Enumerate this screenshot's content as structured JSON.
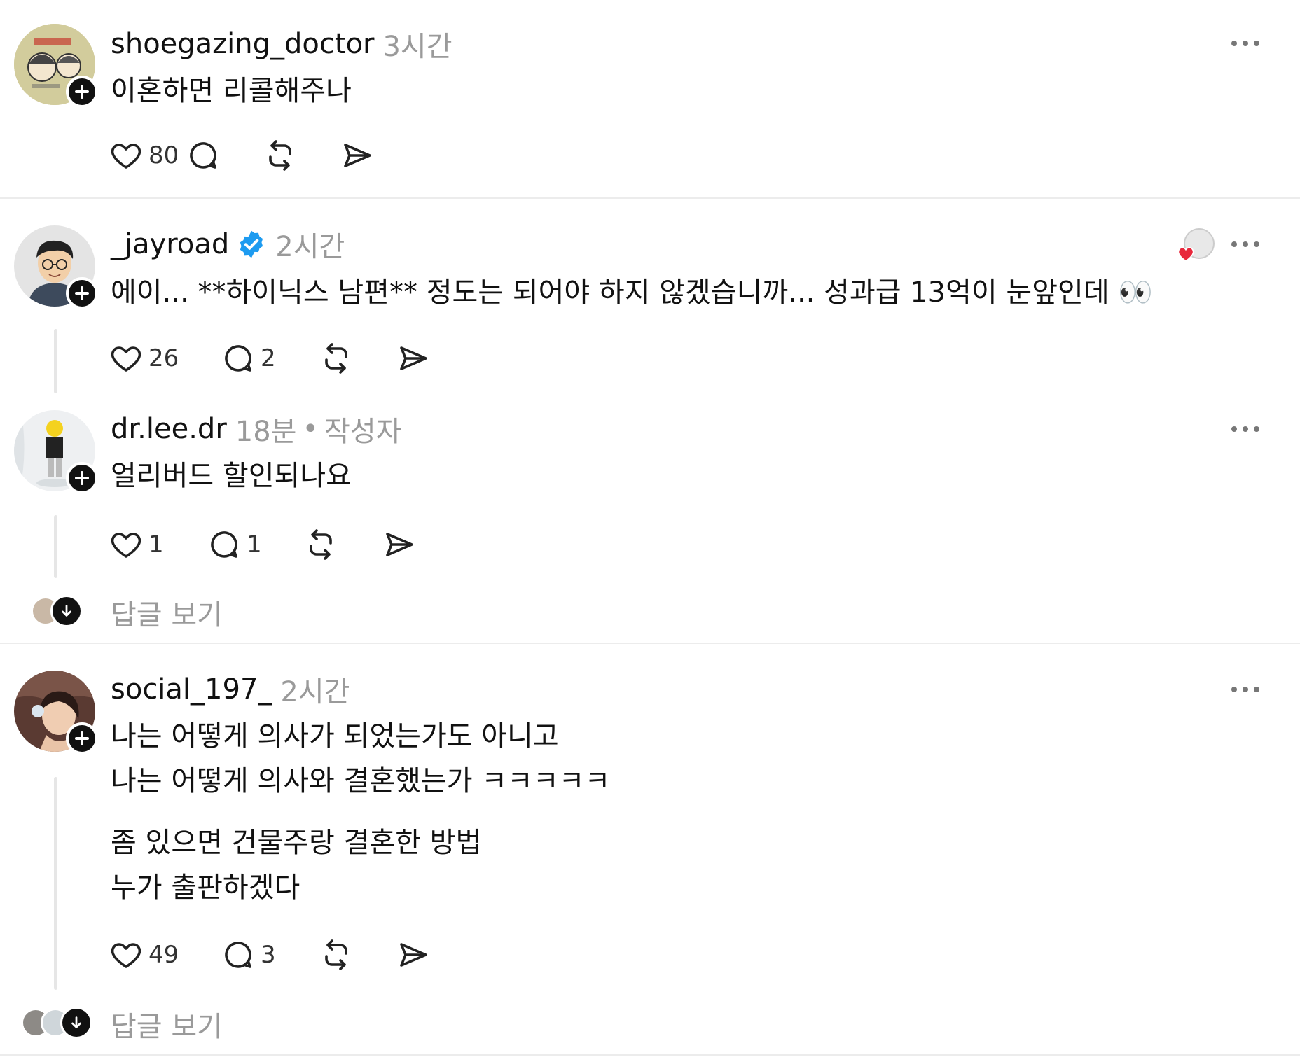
{
  "posts": [
    {
      "username": "shoegazing_doctor",
      "time": "3시간",
      "text_lines": [
        "이혼하면 리콜해주나"
      ],
      "likes": "80",
      "replies": "",
      "avatar_colors": {
        "bg": "#cfc998",
        "accent": "#c43b2f"
      }
    },
    {
      "username": "_jayroad",
      "verified": true,
      "time": "2시간",
      "text_lines": [
        "에이... **하이닉스 남편** 정도는 되어야 하지 않겠습니까... 성과급 13억이 눈앞인데 👀"
      ],
      "likes": "26",
      "replies": "2"
    },
    {
      "username": "dr.lee.dr",
      "time": "18분",
      "author_tag": "작성자",
      "separator": "•",
      "text_lines": [
        "얼리버드 할인되나요"
      ],
      "likes": "1",
      "replies": "1",
      "view_replies": "답글 보기"
    },
    {
      "username": "social_197_",
      "time": "2시간",
      "text_lines": [
        "나는 어떻게 의사가 되었는가도 아니고",
        "나는 어떻게 의사와 결혼했는가 ㅋㅋㅋㅋㅋ",
        "좀 있으면 건물주랑 결혼한 방법",
        "누가 출판하겠다"
      ],
      "likes": "49",
      "replies": "3",
      "view_replies": "답글 보기"
    }
  ],
  "icons": {
    "like": "heart-outline-icon",
    "reply": "speech-bubble-icon",
    "repost": "repost-arrows-icon",
    "share": "send-arrow-icon",
    "more": "more-dots-icon",
    "verified": "verified-badge-icon",
    "follow": "plus-icon"
  },
  "colors": {
    "verified": "#1d9bf0",
    "muted": "#9a9a9a",
    "like_heart": "#e8283c"
  }
}
